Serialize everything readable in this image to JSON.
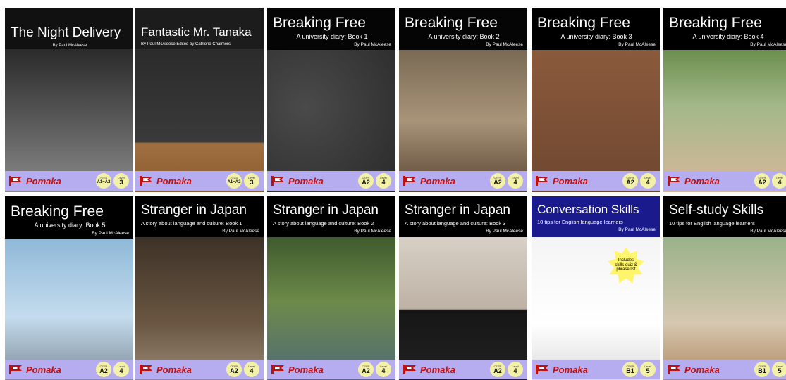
{
  "brand": {
    "name": "Pomaka",
    "color": "#c01010",
    "bar_color": "#b6adf0"
  },
  "labels": {
    "cefr": "CEFR",
    "level": "Level"
  },
  "books": [
    {
      "title": "The Night Delivery",
      "subtitle": "",
      "author": "By Paul McAleese",
      "cefr": "A1~A2",
      "level": "3"
    },
    {
      "title": "Fantastic Mr. Tanaka",
      "subtitle": "",
      "author": "By Paul McAleese      Edited by Catriona Chalmers",
      "cefr": "A1~A2",
      "level": "3"
    },
    {
      "title": "Breaking Free",
      "subtitle": "A university diary: Book 1",
      "author": "By Paul McAleese",
      "cefr": "A2",
      "level": "4"
    },
    {
      "title": "Breaking Free",
      "subtitle": "A university diary: Book 2",
      "author": "By Paul McAleese",
      "cefr": "A2",
      "level": "4"
    },
    {
      "title": "Breaking Free",
      "subtitle": "A university diary: Book 3",
      "author": "By Paul McAleese",
      "cefr": "A2",
      "level": "4"
    },
    {
      "title": "Breaking Free",
      "subtitle": "A university diary: Book 4",
      "author": "By Paul McAleese",
      "cefr": "A2",
      "level": "4"
    },
    {
      "title": "Breaking Free",
      "subtitle": "A university diary: Book 5",
      "author": "By Paul McAleese",
      "cefr": "A2",
      "level": "4"
    },
    {
      "title": "Stranger in Japan",
      "subtitle": "A story about language and culture: Book 1",
      "author": "By Paul McAleese",
      "cefr": "A2",
      "level": "4"
    },
    {
      "title": "Stranger in Japan",
      "subtitle": "A story about language and culture: Book 2",
      "author": "By Paul McAleese",
      "cefr": "A2",
      "level": "4"
    },
    {
      "title": "Stranger in Japan",
      "subtitle": "A story about language and culture: Book 3",
      "author": "By Paul McAleese",
      "cefr": "A2",
      "level": "4"
    },
    {
      "title": "Conversation Skills",
      "subtitle": "10 tips for English language learners",
      "author": "By Paul McAleese",
      "cefr": "B1",
      "level": "5",
      "burst": "Includes skills quiz & phrase list"
    },
    {
      "title": "Self-study Skills",
      "subtitle": "10 tips for English language learners",
      "author": "By Paul McAleese",
      "cefr": "B1",
      "level": "5"
    }
  ]
}
